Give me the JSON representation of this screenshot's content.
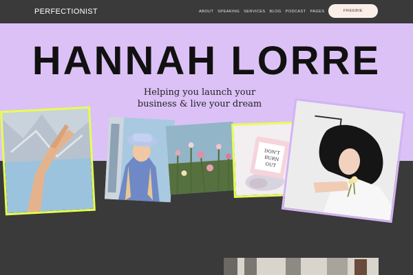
{
  "brand": {
    "logo": "PERFECTIONIST"
  },
  "nav": {
    "items": [
      "ABOUT",
      "SPEAKING",
      "SERVICES",
      "BLOG",
      "PODCAST",
      "PAGES"
    ],
    "cta": "FREEBIE"
  },
  "hero": {
    "title": "HANNAH LORRE",
    "tagline_line1": "Helping you launch your",
    "tagline_line2": "business & live your dream"
  },
  "photos": [
    {
      "icon": "hand-reaching-photo"
    },
    {
      "icon": "woman-bucket-hat-photo"
    },
    {
      "icon": "wildflowers-photo"
    },
    {
      "icon": "dont-burn-out-book-photo",
      "text": "DON'T BURN OUT"
    },
    {
      "icon": "woman-lying-flowers-photo"
    }
  ],
  "colors": {
    "hero_bg": "#dcc1f6",
    "dark_bg": "#3a3a3a",
    "accent_yellow": "#e8ff4e",
    "accent_lilac": "#d2b3f3",
    "cta_bg": "#fbeee8"
  }
}
